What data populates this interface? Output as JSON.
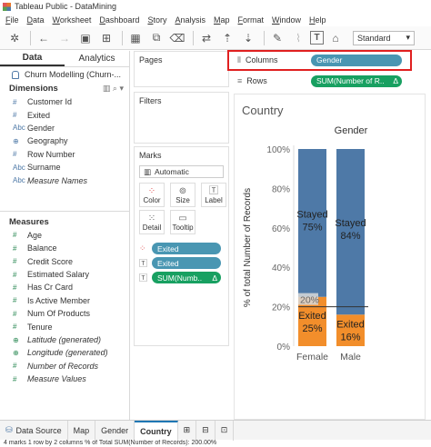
{
  "window": {
    "title": "Tableau Public - DataMining"
  },
  "menu": [
    "File",
    "Data",
    "Worksheet",
    "Dashboard",
    "Story",
    "Analysis",
    "Map",
    "Format",
    "Window",
    "Help"
  ],
  "toolbar": {
    "fit_select": "Standard"
  },
  "data_pane": {
    "tabs": [
      "Data",
      "Analytics"
    ],
    "datasource": "Churn Modelling (Churn-...",
    "dimensions_title": "Dimensions",
    "dimensions": [
      {
        "icon": "#",
        "label": "Customer Id"
      },
      {
        "icon": "#",
        "label": "Exited"
      },
      {
        "icon": "Abc",
        "label": "Gender"
      },
      {
        "icon": "⊕",
        "label": "Geography"
      },
      {
        "icon": "#",
        "label": "Row Number"
      },
      {
        "icon": "Abc",
        "label": "Surname"
      },
      {
        "icon": "Abc",
        "label": "Measure Names"
      }
    ],
    "measures_title": "Measures",
    "measures": [
      {
        "icon": "#",
        "label": "Age"
      },
      {
        "icon": "#",
        "label": "Balance"
      },
      {
        "icon": "#",
        "label": "Credit Score"
      },
      {
        "icon": "#",
        "label": "Estimated Salary"
      },
      {
        "icon": "#",
        "label": "Has Cr Card"
      },
      {
        "icon": "#",
        "label": "Is Active Member"
      },
      {
        "icon": "#",
        "label": "Num Of Products"
      },
      {
        "icon": "#",
        "label": "Tenure"
      },
      {
        "icon": "⊕",
        "label": "Latitude (generated)"
      },
      {
        "icon": "⊕",
        "label": "Longitude (generated)"
      },
      {
        "icon": "#",
        "label": "Number of Records"
      },
      {
        "icon": "#",
        "label": "Measure Values"
      }
    ]
  },
  "cards": {
    "pages": "Pages",
    "filters": "Filters",
    "marks": "Marks",
    "mark_type": "Automatic",
    "mark_buttons": [
      "Color",
      "Size",
      "Label",
      "Detail",
      "Tooltip"
    ],
    "mark_pills": [
      {
        "icon": "color",
        "label": "Exited",
        "color": "#4996b2"
      },
      {
        "icon": "text",
        "label": "Exited",
        "color": "#4996b2"
      },
      {
        "icon": "text",
        "label": "SUM(Numb..",
        "color": "#18a061",
        "delta": "Δ"
      }
    ]
  },
  "shelves": {
    "columns_label": "Columns",
    "columns_pill": "Gender",
    "rows_label": "Rows",
    "rows_pill": "SUM(Number of R..",
    "rows_delta": "Δ"
  },
  "viz": {
    "sheet_title": "Country",
    "colors": {
      "stayed": "#4e79a7",
      "exited": "#f28e2b",
      "highlight": "#e02020"
    }
  },
  "chart_data": {
    "type": "bar",
    "stacked": true,
    "title": "Gender",
    "xlabel": "",
    "ylabel": "% of total Number of Records",
    "categories": [
      "Female",
      "Male"
    ],
    "series": [
      {
        "name": "Exited",
        "values": [
          25,
          16
        ],
        "labels": [
          "Exited\n25%",
          "Exited\n16%"
        ]
      },
      {
        "name": "Stayed",
        "values": [
          75,
          84
        ],
        "labels": [
          "Stayed\n75%",
          "Stayed\n84%"
        ]
      }
    ],
    "ylim": [
      0,
      100
    ],
    "yticks": [
      "0%",
      "20%",
      "40%",
      "60%",
      "80%",
      "100%"
    ],
    "reference_line": {
      "value": 20,
      "label": "20%"
    },
    "grid": false
  },
  "bottom_tabs": [
    "Data Source",
    "Map",
    "Gender",
    "Country"
  ],
  "active_tab": "Country",
  "status": "4 marks    1 row by 2 columns    % of Total SUM(Number of Records): 200.00%"
}
